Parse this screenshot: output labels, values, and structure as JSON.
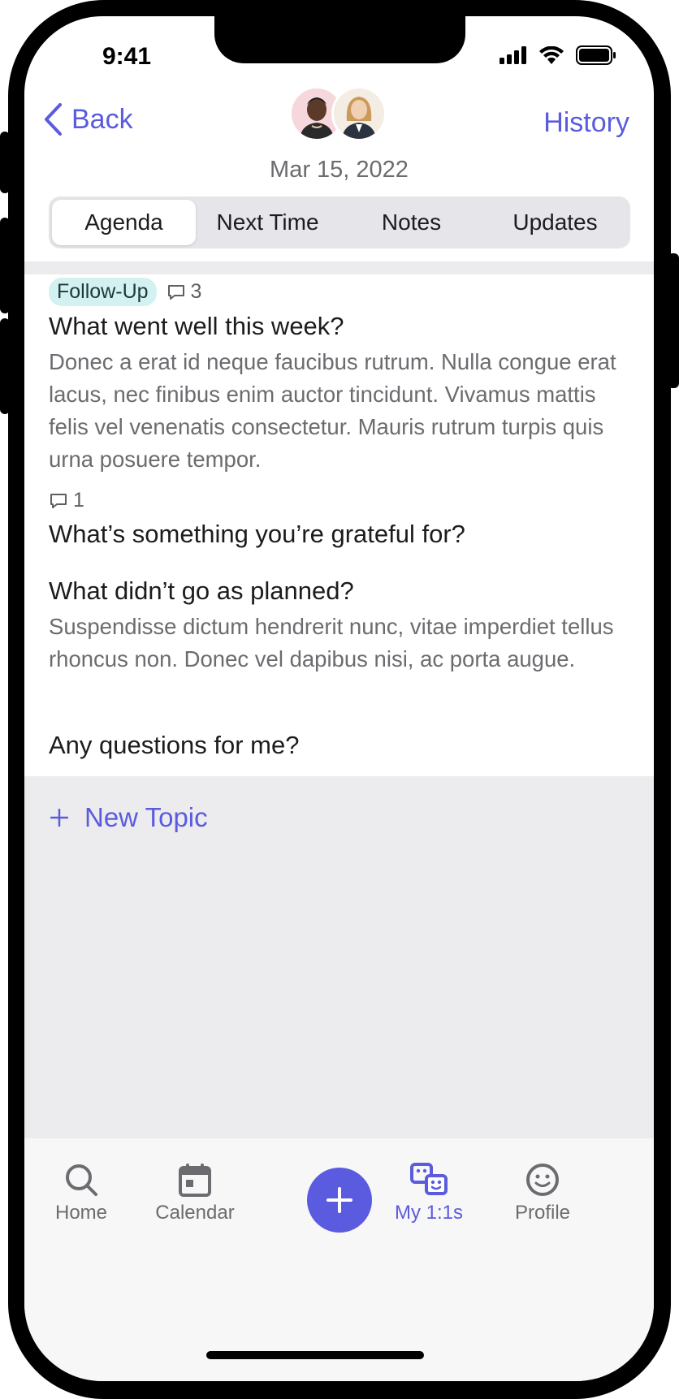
{
  "status": {
    "time": "9:41"
  },
  "nav": {
    "back_label": "Back",
    "history_label": "History",
    "date": "Mar 15, 2022"
  },
  "tabs": [
    {
      "label": "Agenda",
      "active": true
    },
    {
      "label": "Next Time",
      "active": false
    },
    {
      "label": "Notes",
      "active": false
    },
    {
      "label": "Updates",
      "active": false
    }
  ],
  "topics": [
    {
      "badge": "Follow-Up",
      "comment_count": "3",
      "title": "What went well this week?",
      "body": "Donec a erat id neque faucibus rutrum. Nulla congue erat lacus, nec finibus enim auctor tincidunt. Vivamus mattis felis vel venenatis consectetur. Mauris rutrum turpis quis urna posuere tempor."
    },
    {
      "comment_count": "1",
      "title": "What’s something you’re grateful for?"
    },
    {
      "title": "What didn’t go as planned?",
      "body": "Suspendisse dictum hendrerit nunc, vitae imperdiet tellus rhoncus non. Donec vel dapibus nisi, ac porta augue."
    },
    {
      "title": "Any questions for me?"
    }
  ],
  "new_topic_label": "New Topic",
  "tabbar": {
    "home": "Home",
    "calendar": "Calendar",
    "my_1on1s": "My 1:1s",
    "profile": "Profile"
  },
  "colors": {
    "accent": "#5b5bdf",
    "badge_bg": "#d4f1f1",
    "secondary_text": "#6c6c70"
  }
}
